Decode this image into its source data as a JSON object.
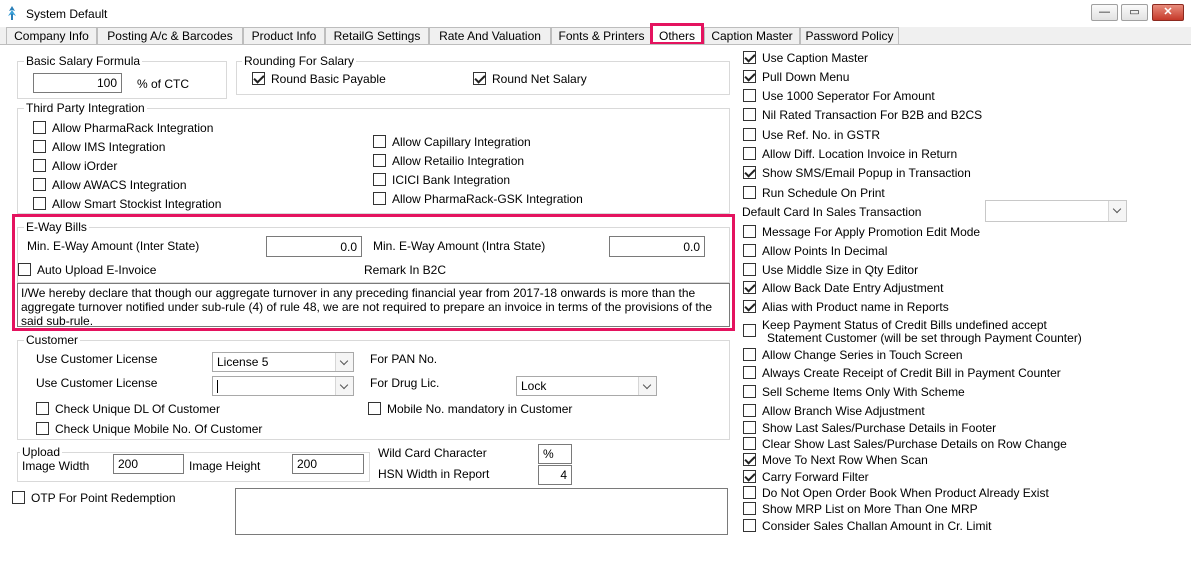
{
  "window": {
    "title": "System Default",
    "minimize": "—",
    "maximize": "▭",
    "close": "✕"
  },
  "tabs": [
    {
      "label": "Company Info"
    },
    {
      "label": "Posting A/c & Barcodes"
    },
    {
      "label": "Product Info"
    },
    {
      "label": "RetailG Settings"
    },
    {
      "label": "Rate And Valuation"
    },
    {
      "label": "Fonts & Printers"
    },
    {
      "label": "Others",
      "active": true
    },
    {
      "label": "Caption Master"
    },
    {
      "label": "Password Policy"
    }
  ],
  "salary": {
    "label": "Basic Salary Formula",
    "value": "100",
    "suffix": "% of CTC"
  },
  "rounding": {
    "label": "Rounding For Salary",
    "basic": {
      "label": "Round Basic Payable",
      "checked": true
    },
    "net": {
      "label": "Round Net Salary",
      "checked": true
    }
  },
  "third_party": {
    "label": "Third Party Integration",
    "left": [
      {
        "label": "Allow PharmaRack Integration",
        "checked": false
      },
      {
        "label": "Allow IMS Integration",
        "checked": false
      },
      {
        "label": "Allow iOrder",
        "checked": false
      },
      {
        "label": "Allow AWACS Integration",
        "checked": false
      },
      {
        "label": "Allow Smart Stockist Integration",
        "checked": false
      }
    ],
    "right": [
      {
        "label": "Allow Capillary Integration",
        "checked": false
      },
      {
        "label": "Allow Retailio Integration",
        "checked": false
      },
      {
        "label": "ICICI Bank Integration",
        "checked": false
      },
      {
        "label": "Allow PharmaRack-GSK Integration",
        "checked": false
      }
    ]
  },
  "eway": {
    "label": "E-Way Bills",
    "inter_label": "Min. E-Way Amount (Inter State)",
    "inter_value": "0.0",
    "intra_label": "Min. E-Way Amount (Intra State)",
    "intra_value": "0.0",
    "auto_upload": {
      "label": "Auto Upload E-Invoice",
      "checked": false
    },
    "remark_label": "Remark In B2C",
    "remark_text": "I/We hereby declare that though our aggregate turnover in any preceding financial year from 2017-18 onwards is more than the aggregate turnover notified under sub-rule (4) of rule 48, we are not required to prepare an invoice in terms of the provisions of the said sub-rule."
  },
  "customer": {
    "label": "Customer",
    "license1_label": "Use Customer License",
    "license1_value": "License 5",
    "license2_label": "Use Customer License",
    "license2_value": "",
    "pan_label": "For PAN No.",
    "drug_label": "For Drug Lic.",
    "drug_value": "Lock",
    "check_dl": {
      "label": "Check Unique DL Of Customer",
      "checked": false
    },
    "check_mobile": {
      "label": "Check Unique Mobile No. Of Customer",
      "checked": false
    },
    "mobile_mandatory": {
      "label": "Mobile No. mandatory in Customer",
      "checked": false
    }
  },
  "upload": {
    "label": "Upload",
    "width_label": "Image Width",
    "width_value": "200",
    "height_label": "Image Height",
    "height_value": "200"
  },
  "wildcard": {
    "label": "Wild Card Character",
    "value": "%"
  },
  "hsn": {
    "label": "HSN Width in Report",
    "value": "4"
  },
  "otp": {
    "label": "OTP For Point Redemption",
    "checked": false
  },
  "default_card": {
    "label": "Default Card In Sales Transaction",
    "value": ""
  },
  "right_options_a": [
    {
      "label": "Use Caption Master",
      "checked": true
    },
    {
      "label": "Pull Down Menu",
      "checked": true
    },
    {
      "label": "Use 1000 Seperator For Amount",
      "checked": false
    },
    {
      "label": "Nil Rated Transaction For B2B and B2CS",
      "checked": false
    },
    {
      "label": "Use Ref. No. in GSTR",
      "checked": false
    },
    {
      "label": "Allow Diff. Location Invoice in Return",
      "checked": false
    },
    {
      "label": "Show SMS/Email Popup in Transaction",
      "checked": true
    },
    {
      "label": "Run Schedule On Print",
      "checked": false
    }
  ],
  "right_options_b": [
    {
      "label": "Message For Apply Promotion Edit Mode",
      "checked": false
    },
    {
      "label": "Allow Points In Decimal",
      "checked": false
    },
    {
      "label": "Use Middle Size in Qty Editor",
      "checked": false
    },
    {
      "label": "Allow Back Date Entry Adjustment",
      "checked": true
    },
    {
      "label": "Alias with Product name in Reports",
      "checked": true
    }
  ],
  "keep_payment": {
    "line1": "Keep Payment Status of Credit Bills undefined accept",
    "line2": "Statement Customer (will be set through Payment Counter)",
    "checked": false
  },
  "right_options_c": [
    {
      "label": "Allow Change Series in Touch Screen",
      "checked": false
    },
    {
      "label": "Always Create Receipt of Credit Bill in Payment Counter",
      "checked": false
    },
    {
      "label": "Sell Scheme Items Only With Scheme",
      "checked": false
    },
    {
      "label": "Allow Branch Wise Adjustment",
      "checked": false
    },
    {
      "label": "Show Last Sales/Purchase Details in Footer",
      "checked": false
    },
    {
      "label": "Clear Show Last Sales/Purchase Details on Row Change",
      "checked": false
    },
    {
      "label": "Move To Next Row When Scan",
      "checked": true
    },
    {
      "label": "Carry Forward Filter",
      "checked": true
    },
    {
      "label": "Do Not Open Order Book When Product Already Exist",
      "checked": false
    },
    {
      "label": "Show MRP List on More Than One MRP",
      "checked": false
    },
    {
      "label": "Consider Sales Challan Amount in Cr. Limit",
      "checked": false
    }
  ]
}
